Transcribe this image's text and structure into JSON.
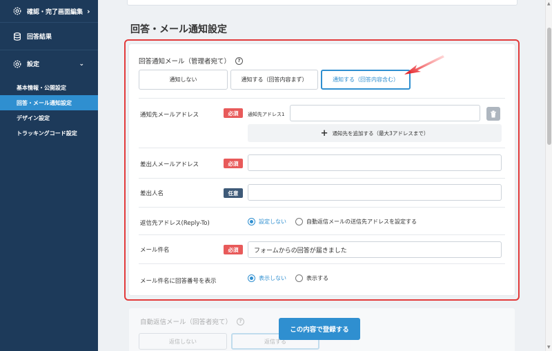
{
  "sidebar": {
    "top_item": "確認・完了画面編集",
    "results": "回答結果",
    "settings": "設定",
    "sub_items": [
      "基本情報・公開設定",
      "回答・メール通知設定",
      "デザイン設定",
      "トラッキングコード設定"
    ]
  },
  "page": {
    "section_title": "回答・メール通知設定"
  },
  "notify": {
    "heading": "回答通知メール（管理者宛て）",
    "options": [
      "通知しない",
      "通知する（回答内容まず）",
      "通知する（回答内容含む）"
    ],
    "selected_index": 2
  },
  "fields": {
    "recipient": {
      "label": "通知先メールアドレス",
      "badge": "必須",
      "addr_label": "通知先アドレス1",
      "value": "",
      "add_button": "通知先を追加する（最大3アドレスまで）"
    },
    "sender_email": {
      "label": "差出人メールアドレス",
      "badge": "必須",
      "value": ""
    },
    "sender_name": {
      "label": "差出人名",
      "badge": "任意",
      "value": ""
    },
    "reply_to": {
      "label": "返信先アドレス(Reply-To)",
      "options": [
        "設定しない",
        "自動返信メールの送信先アドレスを設定する"
      ],
      "selected_index": 0
    },
    "subject": {
      "label": "メール件名",
      "badge": "必須",
      "value": "フォームからの回答が届きました"
    },
    "subject_number": {
      "label": "メール件名に回答番号を表示",
      "options": [
        "表示しない",
        "表示する"
      ],
      "selected_index": 0
    }
  },
  "auto_reply": {
    "heading": "自動返信メール（回答者宛て）",
    "options": [
      "返信しない",
      "返信する"
    ]
  },
  "submit_label": "この内容で登録する",
  "colors": {
    "accent": "#2f8fd0",
    "sidebar": "#1d3a5a",
    "required": "#e85a5a",
    "optional": "#3e5a78",
    "highlight": "#e23a3a"
  }
}
